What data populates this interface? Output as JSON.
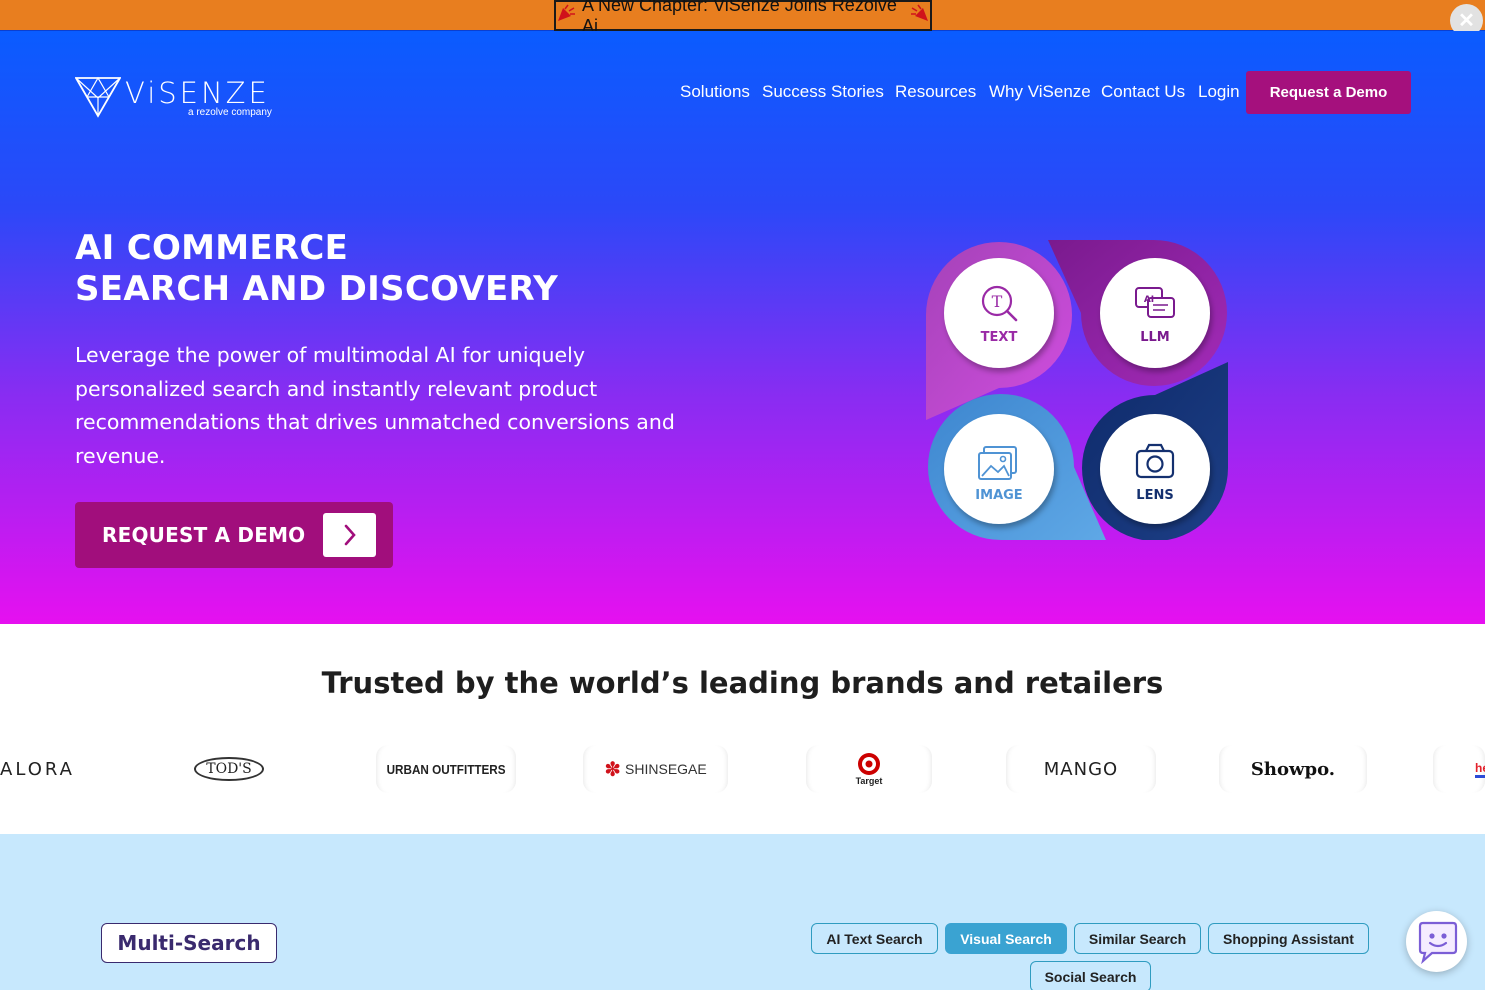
{
  "announcement": {
    "text": "A New Chapter: ViSenze Joins Rezolve Ai",
    "close_glyph": "✕"
  },
  "header": {
    "logo_text": "ViSENZE",
    "logo_sub": "a rezolve company",
    "nav": [
      "Solutions",
      "Success Stories",
      "Resources",
      "Why ViSenze",
      "Contact Us",
      "Login"
    ],
    "demo_button": "Request a Demo"
  },
  "hero": {
    "title_line1": "AI COMMERCE",
    "title_line2": "SEARCH AND DISCOVERY",
    "description": "Leverage the power of multimodal AI for uniquely personalized search and instantly relevant product recommendations that drives unmatched conversions and revenue.",
    "cta": "REQUEST A DEMO",
    "graphic_labels": [
      "TEXT",
      "LLM",
      "IMAGE",
      "LENS"
    ]
  },
  "trusted": {
    "title": "Trusted by the world’s leading brands and retailers",
    "brands": [
      "ALORA",
      "TOD'S",
      "URBAN OUTFITTERS",
      "SHINSEGAE",
      "Target",
      "MANGO",
      "Showpo.",
      "he"
    ]
  },
  "multisearch": {
    "title": "Multi-Search",
    "tabs": [
      "AI Text Search",
      "Visual Search",
      "Similar Search",
      "Shopping Assistant",
      "Social Search"
    ],
    "active_tab": "Visual Search"
  },
  "colors": {
    "announcement": "#e87e1f",
    "accent": "#a5107d",
    "hero_top": "#0a5cff",
    "hero_bottom": "#e610f0",
    "multisearch_bg": "#c7e8fd",
    "tab_active": "#3aa3d2"
  }
}
